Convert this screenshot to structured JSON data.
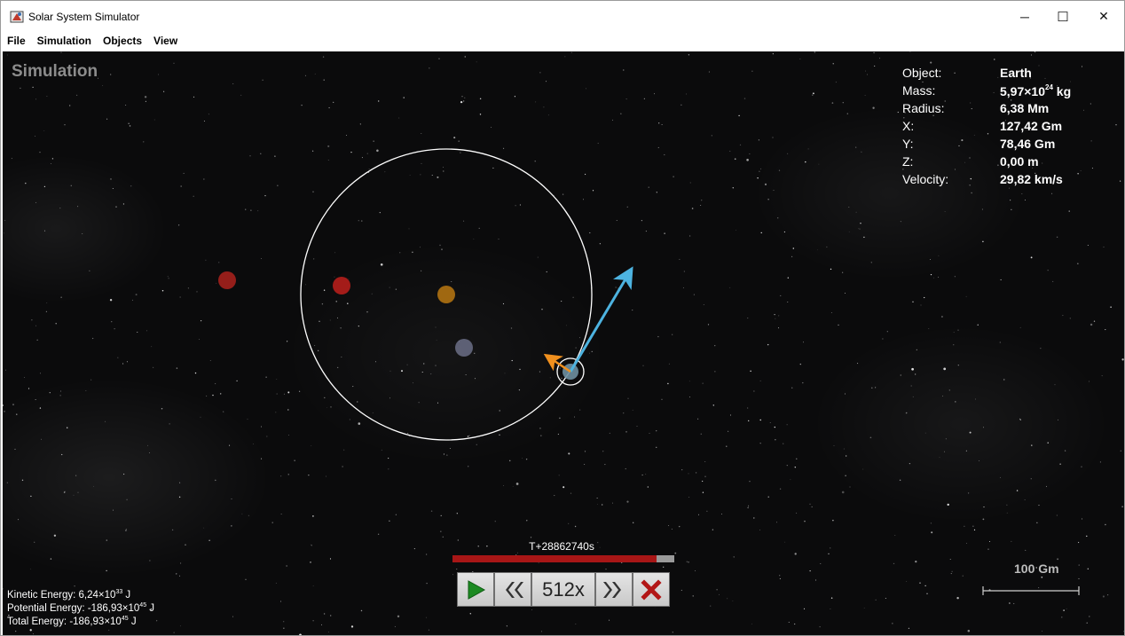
{
  "window": {
    "title": "Solar System Simulator",
    "minimize_glyph": "─",
    "maximize_glyph": "☐",
    "close_glyph": "✕"
  },
  "menu": [
    {
      "label": "File"
    },
    {
      "label": "Simulation"
    },
    {
      "label": "Objects"
    },
    {
      "label": "View"
    }
  ],
  "simulation": {
    "label": "Simulation",
    "colors": {
      "background": "#0b0b0c",
      "orbit": "#ffffff",
      "velocity_vector": "#4db3e0",
      "acceleration_vector": "#f0901e"
    },
    "bodies": [
      {
        "name": "red-planet-left",
        "color": "#b8231e"
      },
      {
        "name": "red-planet",
        "color": "#c0201c"
      },
      {
        "name": "sun",
        "color": "#c47e12"
      },
      {
        "name": "grey-planet",
        "color": "#6b6f86"
      },
      {
        "name": "earth",
        "color": "#6e8fa0",
        "selected": true
      }
    ]
  },
  "info": {
    "object": {
      "key": "Object:",
      "value": "Earth"
    },
    "mass": {
      "key": "Mass:",
      "mantissa": "5,97×10",
      "exponent": "24",
      "unit": " kg"
    },
    "radius": {
      "key": "Radius:",
      "value": "6,38 Mm"
    },
    "x": {
      "key": "X:",
      "value": "127,42 Gm"
    },
    "y": {
      "key": "Y:",
      "value": "78,46 Gm"
    },
    "z": {
      "key": "Z:",
      "value": "0,00 m"
    },
    "velocity": {
      "key": "Velocity:",
      "value": "29,82 km/s"
    }
  },
  "energy": {
    "kinetic": {
      "label": "Kinetic Energy: 6,24×10",
      "exponent": "33",
      "unit": " J"
    },
    "potential": {
      "label": "Potential Energy: -186,93×10",
      "exponent": "45",
      "unit": " J"
    },
    "total": {
      "label": "Total Energy: -186,93×10",
      "exponent": "45",
      "unit": " J"
    }
  },
  "time": {
    "label": "T+28862740s",
    "progress_fraction": 0.92,
    "progress_color": "#a81616"
  },
  "controls": {
    "play_icon": "play-icon",
    "rewind_icon": "rewind-icon",
    "speed": "512x",
    "fast_forward_icon": "fast-forward-icon",
    "stop_icon": "stop-icon",
    "play_color": "#1c8a22",
    "stop_color": "#b21616"
  },
  "scale": {
    "label": "100 Gm"
  }
}
